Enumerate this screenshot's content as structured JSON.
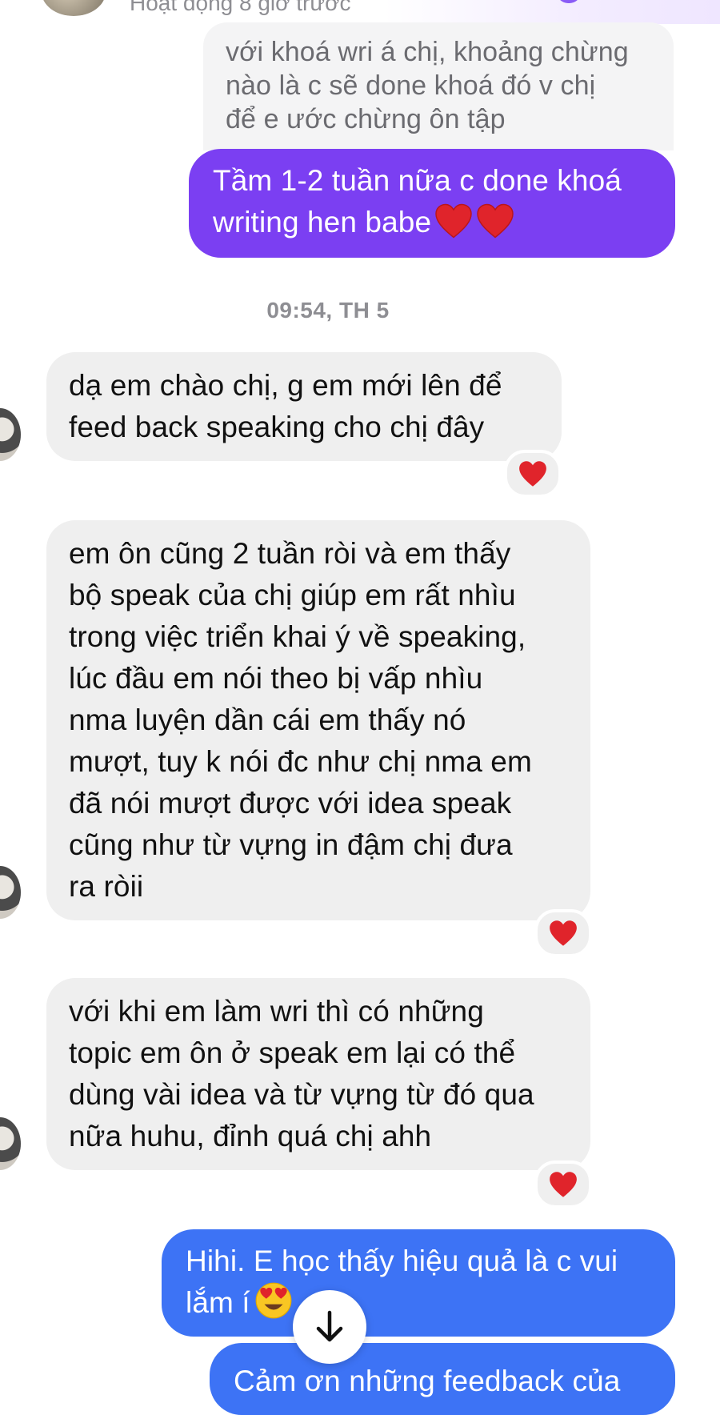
{
  "header": {
    "status": "Hoạt động 8 giờ trước"
  },
  "reply_quote": {
    "lines": [
      "với khoá wri á chị, khoảng chừng",
      "nào là c sẽ done khoá đó v chị",
      "để e ước chừng ôn tập"
    ]
  },
  "messages": {
    "m1": {
      "lines": [
        "Tầm 1-2 tuần nữa c done khoá",
        "writing hen babe"
      ],
      "emojis": [
        "red-heart",
        "red-heart"
      ]
    },
    "timestamp": "09:54, TH 5",
    "m2": {
      "lines": [
        "dạ em chào chị, g em mới lên để",
        "feed back speaking cho chị đây"
      ],
      "reaction": "red-heart"
    },
    "m3": {
      "lines": [
        "em ôn cũng 2 tuần ròi và em thấy",
        "bộ speak của chị giúp em rất nhìu",
        "trong việc triển khai ý về speaking,",
        "lúc đầu em nói theo bị vấp nhìu",
        "nma luyện dần cái em thấy nó",
        "mượt, tuy k nói đc như chị nma em",
        "đã nói mượt được với idea speak",
        "cũng như từ vựng in đậm chị đưa",
        "ra ròii"
      ],
      "reaction": "red-heart"
    },
    "m4": {
      "lines": [
        "với khi em làm wri thì có những",
        "topic em ôn ở speak em lại có thể",
        "dùng vài idea và từ vựng từ đó qua",
        "nữa huhu, đỉnh quá chị ahh"
      ],
      "reaction": "red-heart"
    },
    "m5": {
      "lines": [
        "Hihi. E học thấy hiệu quả là c vui",
        "lắm í"
      ],
      "emoji": "heart-eyes-face"
    },
    "m6": {
      "lines": [
        "Cảm ơn những feedback của"
      ]
    }
  },
  "colors": {
    "outgoing_purple": "#7b3ff2",
    "outgoing_blue": "#3d73f5",
    "incoming_bg": "#efefef",
    "heart": "#e0242b"
  },
  "icons": {
    "scroll_down": "arrow-down-icon"
  }
}
